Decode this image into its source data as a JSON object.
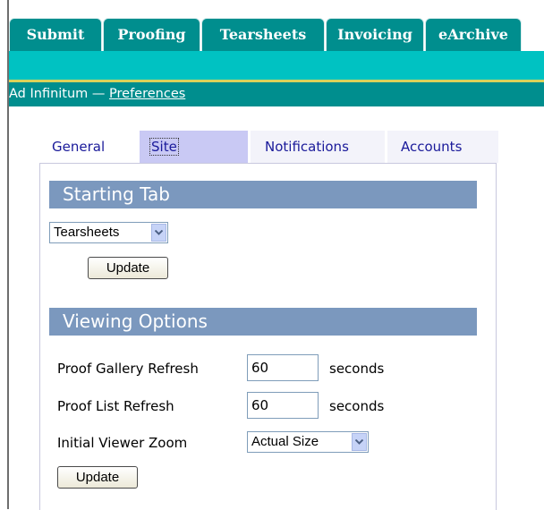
{
  "top_tabs": [
    "Submit",
    "Proofing",
    "Tearsheets",
    "Invoicing",
    "eArchive"
  ],
  "breadcrumb": {
    "org": "Ad Infinitum",
    "separator": " — ",
    "link": "Preferences"
  },
  "pref_tabs": [
    "General",
    "Site",
    "Notifications",
    "Accounts"
  ],
  "starting_tab": {
    "heading": "Starting Tab",
    "selected": "Tearsheets",
    "update_label": "Update"
  },
  "viewing_options": {
    "heading": "Viewing Options",
    "gallery_refresh": {
      "label": "Proof Gallery Refresh",
      "value": "60",
      "unit": "seconds"
    },
    "list_refresh": {
      "label": "Proof List Refresh",
      "value": "60",
      "unit": "seconds"
    },
    "zoom": {
      "label": "Initial Viewer Zoom",
      "selected": "Actual Size"
    },
    "update_label": "Update"
  },
  "colors": {
    "tab_teal": "#008e8e",
    "band_teal": "#00c2c2",
    "section_header": "#7b98be",
    "active_tab": "#c9c9f4"
  }
}
